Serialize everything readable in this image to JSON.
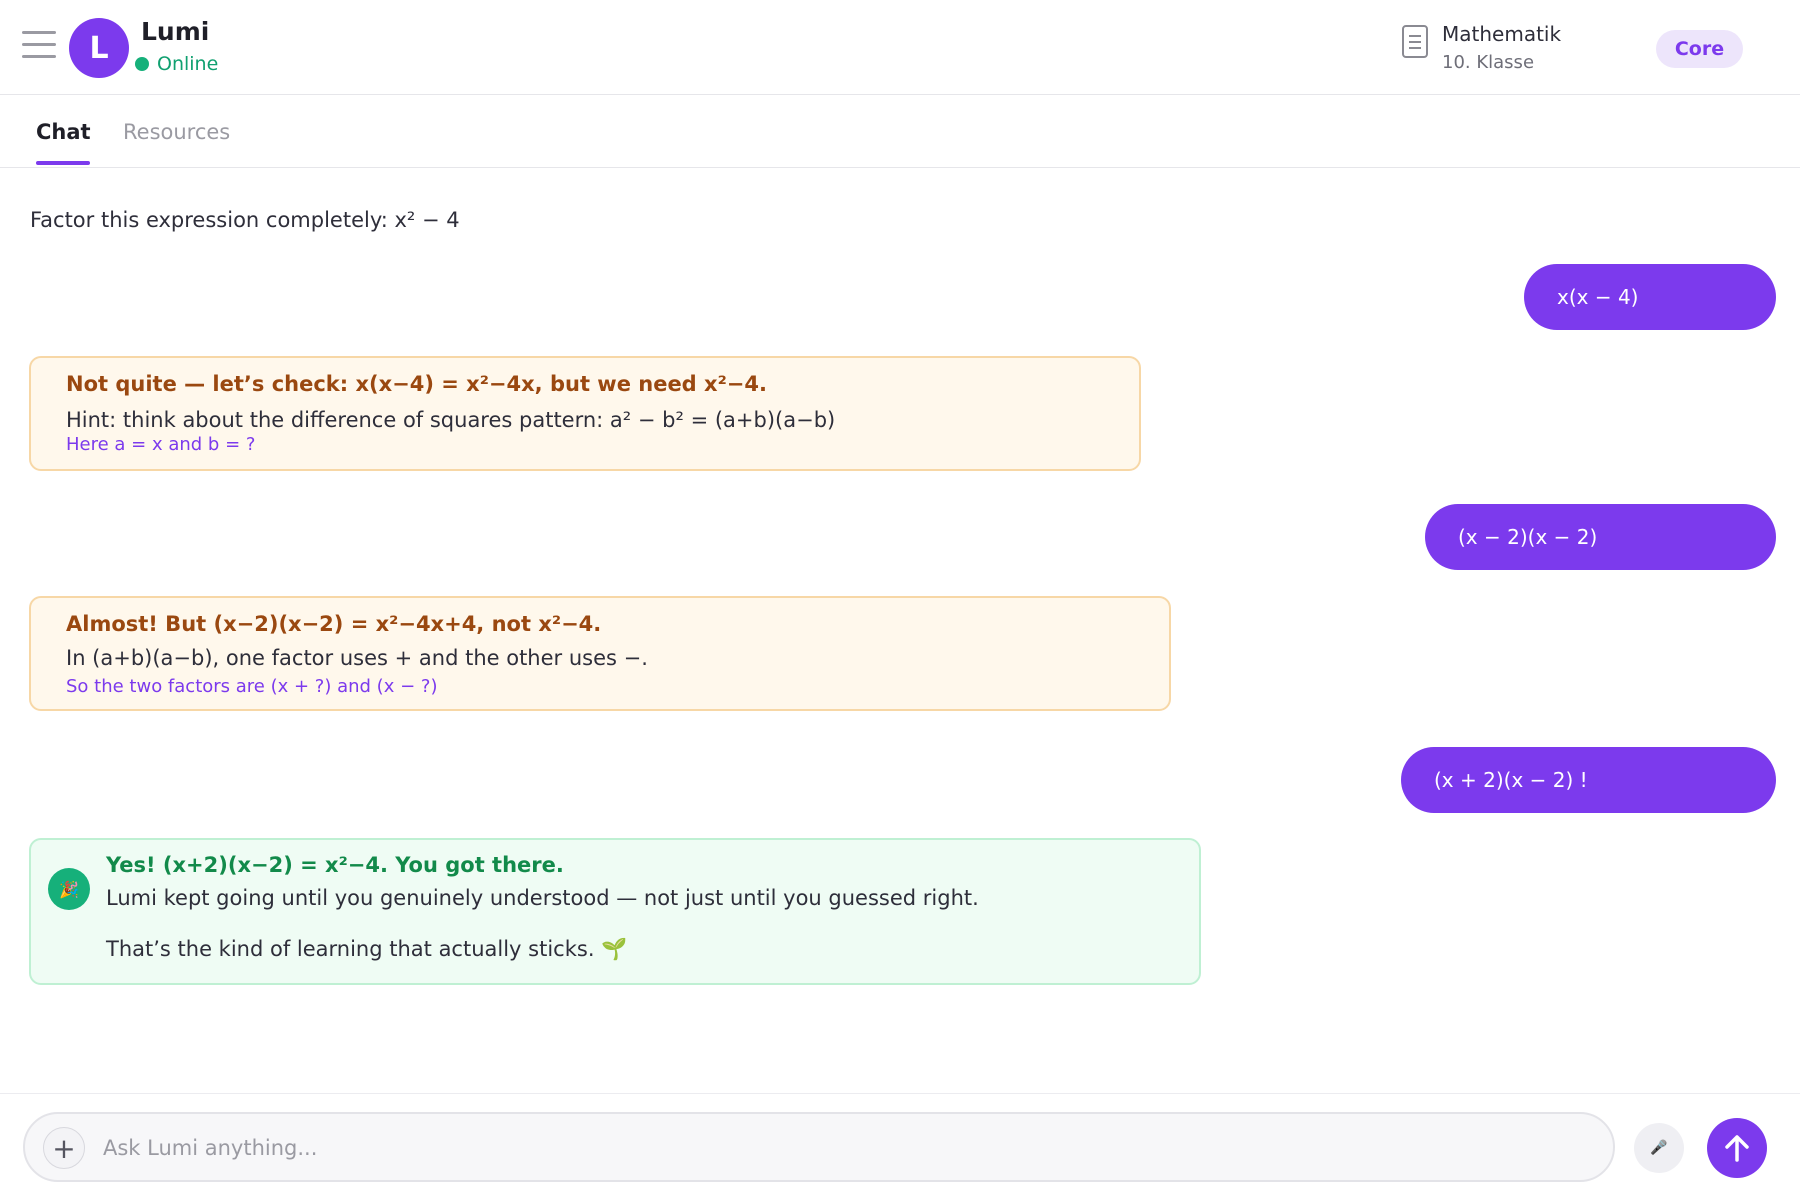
{
  "header": {
    "bot_name": "Lumi",
    "avatar_letter": "L",
    "status": "Online",
    "subject_title": "Mathematik",
    "subject_sub": "10. Klasse",
    "plan_badge": "Core"
  },
  "tabs": [
    {
      "label": "Chat",
      "active": true
    },
    {
      "label": "Resources",
      "active": false
    }
  ],
  "chat": {
    "question": "Factor this expression completely: x² − 4",
    "answers": [
      "x(x − 4)",
      "(x − 2)(x − 2)",
      "(x + 2)(x − 2) !"
    ],
    "hint1": {
      "title": "Not quite — let’s check: x(x−4) = x²−4x, but we need x²−4.",
      "body": "Hint: think about the difference of squares pattern: a² − b² = (a+b)(a−b)",
      "link": "Here a = x and b = ?"
    },
    "hint2": {
      "title": "Almost! But (x−2)(x−2) = x²−4x+4, not x²−4.",
      "body": "In (a+b)(a−b), one factor uses + and the other uses −.",
      "link": "So the two factors are (x + ?) and (x − ?)"
    },
    "success": {
      "icon_glyph": "🎉",
      "title": "Yes! (x+2)(x−2) = x²−4. You got there.",
      "body": "Lumi kept going until you genuinely understood — not just until you guessed right.",
      "closing": "That’s the kind of learning that actually sticks. 🌱"
    }
  },
  "composer": {
    "placeholder": "Ask Lumi anything...",
    "plus": "+",
    "mic_glyph": "🎤"
  },
  "colors": {
    "accent": "#7c3aed",
    "online": "#16b07a",
    "hint_border": "#f7d7a6",
    "success_border": "#bff0d3"
  },
  "icons": [
    "menu-icon",
    "document-icon",
    "plus-icon",
    "microphone-icon",
    "arrow-up-icon",
    "celebration-icon"
  ]
}
